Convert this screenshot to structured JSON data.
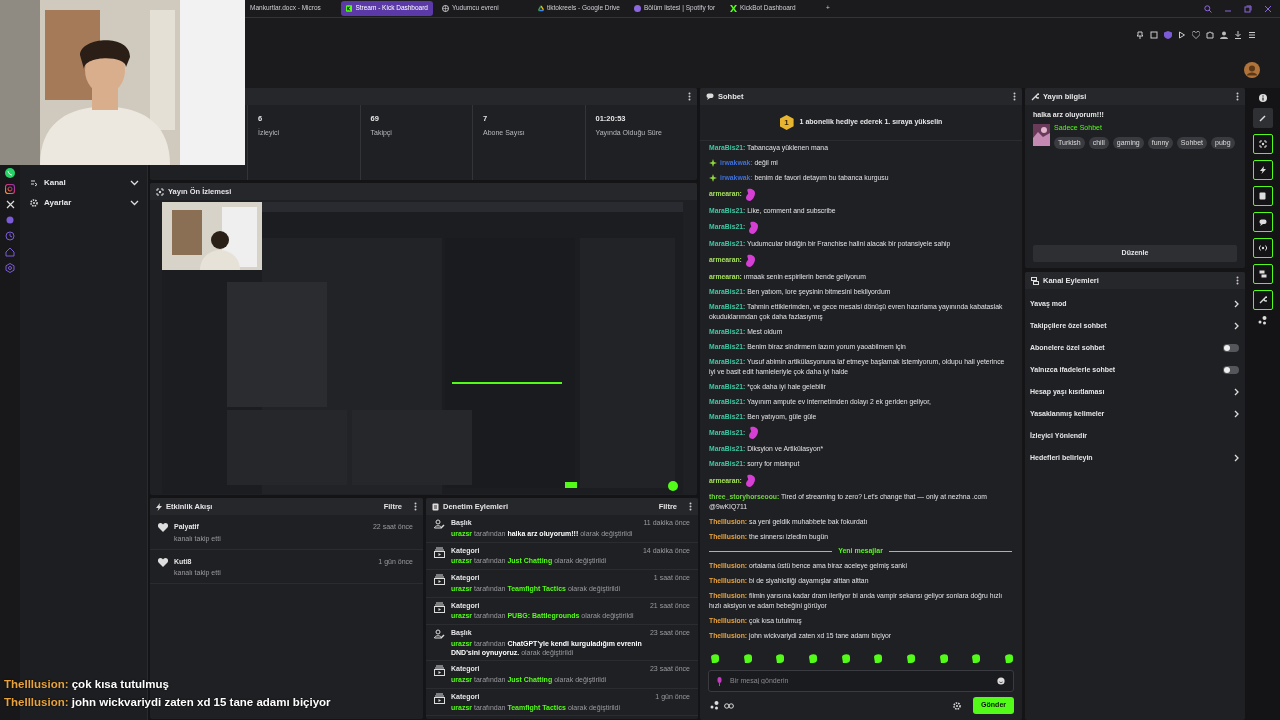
{
  "browser": {
    "tabs": [
      {
        "label": "Mankurtlar.docx - Micros",
        "kind": "plain",
        "selected": false
      },
      {
        "label": "Stream - Kick Dashboard",
        "kind": "kick",
        "selected": true
      },
      {
        "label": "Yudumcu evreni",
        "kind": "globe",
        "selected": false
      },
      {
        "label": "tiktokreels - Google Drive",
        "kind": "drive",
        "selected": false
      },
      {
        "label": "Bölüm listesi | Spotify for",
        "kind": "podcast",
        "selected": false
      },
      {
        "label": "KickBot Dashboard",
        "kind": "bot",
        "selected": false
      }
    ],
    "new_tab": "+"
  },
  "sidebar": {
    "items": [
      {
        "label": "Kanal",
        "kind": "channel",
        "expanded": false
      },
      {
        "label": "Ayarlar",
        "kind": "settings",
        "expanded": false
      }
    ]
  },
  "stats": [
    {
      "value": "6",
      "label": "İzleyici"
    },
    {
      "value": "69",
      "label": "Takipçi"
    },
    {
      "value": "7",
      "label": "Abone Sayısı"
    },
    {
      "value": "01:20:53",
      "label": "Yayında Olduğu Süre"
    }
  ],
  "preview": {
    "title": "Yayın Ön İzlemesi"
  },
  "activity": {
    "title": "Etkinlik Akışı",
    "filter": "Filtre",
    "items": [
      {
        "name": "Palyatif",
        "action": "kanalı takip etti",
        "time": "22 saat önce"
      },
      {
        "name": "Kuti8",
        "action": "kanalı takip etti",
        "time": "1 gün önce"
      }
    ]
  },
  "moderation": {
    "title": "Denetim Eylemleri",
    "filter": "Filtre",
    "items": [
      {
        "kind": "title",
        "label": "Başlık",
        "user": "urazsr",
        "by": "tarafından",
        "value": "halka arz oluyorum!!!",
        "suffix": "olarak değiştirildi",
        "time": "11 dakika önce"
      },
      {
        "kind": "category",
        "label": "Kategori",
        "user": "urazsr",
        "by": "tarafından",
        "value": "Just Chatting",
        "suffix": "olarak değiştirildi",
        "time": "14 dakika önce"
      },
      {
        "kind": "category",
        "label": "Kategori",
        "user": "urazsr",
        "by": "tarafından",
        "value": "Teamfight Tactics",
        "suffix": "olarak değiştirildi",
        "time": "1 saat önce"
      },
      {
        "kind": "category",
        "label": "Kategori",
        "user": "urazsr",
        "by": "tarafından",
        "value": "PUBG: Battlegrounds",
        "suffix": "olarak değiştirildi",
        "time": "21 saat önce"
      },
      {
        "kind": "title",
        "label": "Başlık",
        "user": "urazsr",
        "by": "tarafından",
        "value": "ChatGPT'yle kendi kurguladığım evrenin DND'sini oynuyoruz.",
        "suffix": "olarak değiştirildi",
        "time": "23 saat önce"
      },
      {
        "kind": "category",
        "label": "Kategori",
        "user": "urazsr",
        "by": "tarafından",
        "value": "Just Chatting",
        "suffix": "olarak değiştirildi",
        "time": "23 saat önce"
      },
      {
        "kind": "category",
        "label": "Kategori",
        "user": "urazsr",
        "by": "tarafından",
        "value": "Teamfight Tactics",
        "suffix": "olarak değiştirildi",
        "time": "1 gün önce"
      }
    ]
  },
  "chat": {
    "title": "Sohbet",
    "announcement": {
      "rank": "1",
      "text": "1 abonelik hediye ederek 1. sıraya yükselin"
    },
    "messages": [
      {
        "kind": "text",
        "user": "MaraBis21:",
        "color": "#3ec7a4",
        "badge": false,
        "text": "Tabancaya yüklenen mana"
      },
      {
        "kind": "text",
        "user": "irwakwak:",
        "color": "#3f6fd8",
        "badge": true,
        "text": "değil mi"
      },
      {
        "kind": "text",
        "user": "irwakwak:",
        "color": "#3f6fd8",
        "badge": true,
        "text": "benim de favori detayım bu tabanca kurgusu"
      },
      {
        "kind": "emote",
        "user": "armearan:",
        "color": "#a6e05a",
        "badge": false
      },
      {
        "kind": "text",
        "user": "MaraBis21:",
        "color": "#3ec7a4",
        "badge": false,
        "text": "Like, comment and subscribe"
      },
      {
        "kind": "emote",
        "user": "MaraBis21:",
        "color": "#3ec7a4",
        "badge": false
      },
      {
        "kind": "text",
        "user": "MaraBis21:",
        "color": "#3ec7a4",
        "badge": false,
        "text": "Yudumcular bildiğin bir Franchise halini alacak bir potansiyele sahip"
      },
      {
        "kind": "emote",
        "user": "armearan:",
        "color": "#a6e05a",
        "badge": false
      },
      {
        "kind": "text",
        "user": "armearan:",
        "color": "#a6e05a",
        "badge": false,
        "text": "ırmaak senin espirilerin bende geliyorum"
      },
      {
        "kind": "text",
        "user": "MaraBis21:",
        "color": "#3ec7a4",
        "badge": false,
        "text": "Ben yatıom, lore şeysinin bitmesini bekliyordum"
      },
      {
        "kind": "text",
        "user": "MaraBis21:",
        "color": "#3ec7a4",
        "badge": false,
        "text": "Tahmin ettiklerimden, ve gece mesaisi dönüşü evren hazırlama yayınında kabataslak okuduklarımdan çok daha fazlasıymış"
      },
      {
        "kind": "text",
        "user": "MaraBis21:",
        "color": "#3ec7a4",
        "badge": false,
        "text": "Mest oldum"
      },
      {
        "kind": "text",
        "user": "MaraBis21:",
        "color": "#3ec7a4",
        "badge": false,
        "text": "Benim biraz sindirmem lazım yorum yaoabilmem için"
      },
      {
        "kind": "text",
        "user": "MaraBis21:",
        "color": "#3ec7a4",
        "badge": false,
        "text": "Yusuf abimin artikülasyonuna laf etmeye başlamak istemiyorum, oldupu hali yeterince iyi ve basit edit hamleleriyle çok daha iyi halde"
      },
      {
        "kind": "text",
        "user": "MaraBis21:",
        "color": "#3ec7a4",
        "badge": false,
        "text": "*çok daha iyi hale gelebilir"
      },
      {
        "kind": "text",
        "user": "MaraBis21:",
        "color": "#3ec7a4",
        "badge": false,
        "text": "Yayınım ampute ev internetimden dolayı 2 ek geriden geliyor,"
      },
      {
        "kind": "text",
        "user": "MaraBis21:",
        "color": "#3ec7a4",
        "badge": false,
        "text": "Ben yatıyom, güle güle"
      },
      {
        "kind": "emote",
        "user": "MaraBis21:",
        "color": "#3ec7a4",
        "badge": false
      },
      {
        "kind": "text",
        "user": "MaraBis21:",
        "color": "#3ec7a4",
        "badge": false,
        "text": "Diksyion ve Artikülasyon*"
      },
      {
        "kind": "text",
        "user": "MaraBis21:",
        "color": "#3ec7a4",
        "badge": false,
        "text": "sorry for misinput"
      },
      {
        "kind": "emote",
        "user": "armearan:",
        "color": "#a6e05a",
        "badge": false
      },
      {
        "kind": "text",
        "user": "three_storyhorseoou:",
        "color": "#6fd63a",
        "badge": false,
        "text": "Tired of streaming to zero? Let's change that — only at nezhna .com @9wKIQ711"
      },
      {
        "kind": "text",
        "user": "TheIllusion:",
        "color": "#e8a33d",
        "badge": false,
        "text": "sa yeni geldik muhabbete bak fokurdatı"
      },
      {
        "kind": "text",
        "user": "TheIllusion:",
        "color": "#e8a33d",
        "badge": false,
        "text": "the sinnersı izledim bugün"
      },
      {
        "kind": "divider",
        "text": "Yeni mesajlar"
      },
      {
        "kind": "text",
        "user": "TheIllusion:",
        "color": "#e8a33d",
        "badge": false,
        "text": "ortalama üstü bence ama biraz aceleye gelmiş sanki"
      },
      {
        "kind": "text",
        "user": "TheIllusion:",
        "color": "#e8a33d",
        "badge": false,
        "text": "bi de siyahiciliği dayamışlar alttan alttan"
      },
      {
        "kind": "text",
        "user": "TheIllusion:",
        "color": "#e8a33d",
        "badge": false,
        "text": "filmin yarısına kadar dram ilerliyor bi anda vampir sekansı geliyor sonlara doğru hızlı hızlı aksiyon ve adam bebeğini görüyor"
      },
      {
        "kind": "text",
        "user": "TheIllusion:",
        "color": "#e8a33d",
        "badge": false,
        "text": "çok kısa tutulmuş"
      },
      {
        "kind": "text",
        "user": "TheIllusion:",
        "color": "#e8a33d",
        "badge": false,
        "text": "john wickvariydi zaten xd 15 tane adamı biçiyor"
      }
    ],
    "input": {
      "placeholder": "Bir mesaj gönderin"
    },
    "send": "Gönder"
  },
  "stream_info": {
    "title": "Yayın bilgisi",
    "stream_title": "halka arz oluyorum!!!",
    "category": "Sadece Sohbet",
    "tags": [
      "Turkish",
      "chill",
      "gaming",
      "funny",
      "Sohbet",
      "pubg"
    ],
    "edit": "Düzenle"
  },
  "channel_actions": {
    "title": "Kanal Eylemleri",
    "items": [
      {
        "label": "Yavaş mod",
        "kind": "link"
      },
      {
        "label": "Takipçilere özel sohbet",
        "kind": "link"
      },
      {
        "label": "Abonelere özel sohbet",
        "kind": "toggle",
        "on": false
      },
      {
        "label": "Yalnızca ifadelerle sohbet",
        "kind": "toggle",
        "on": false
      },
      {
        "label": "Hesap yaşı kısıtlaması",
        "kind": "link"
      },
      {
        "label": "Yasaklanmış kelimeler",
        "kind": "link"
      },
      {
        "label": "İzleyici Yönlendir",
        "kind": "plain"
      },
      {
        "label": "Hedefleri belirleyin",
        "kind": "link"
      }
    ]
  },
  "overlay_chat": [
    {
      "user": "TheIllusion:",
      "color": "#e8a33d",
      "text": "çok kısa tutulmuş"
    },
    {
      "user": "TheIllusion:",
      "color": "#e8a33d",
      "text": "john wickvariydi zaten xd 15 tane adamı biçiyor"
    }
  ]
}
